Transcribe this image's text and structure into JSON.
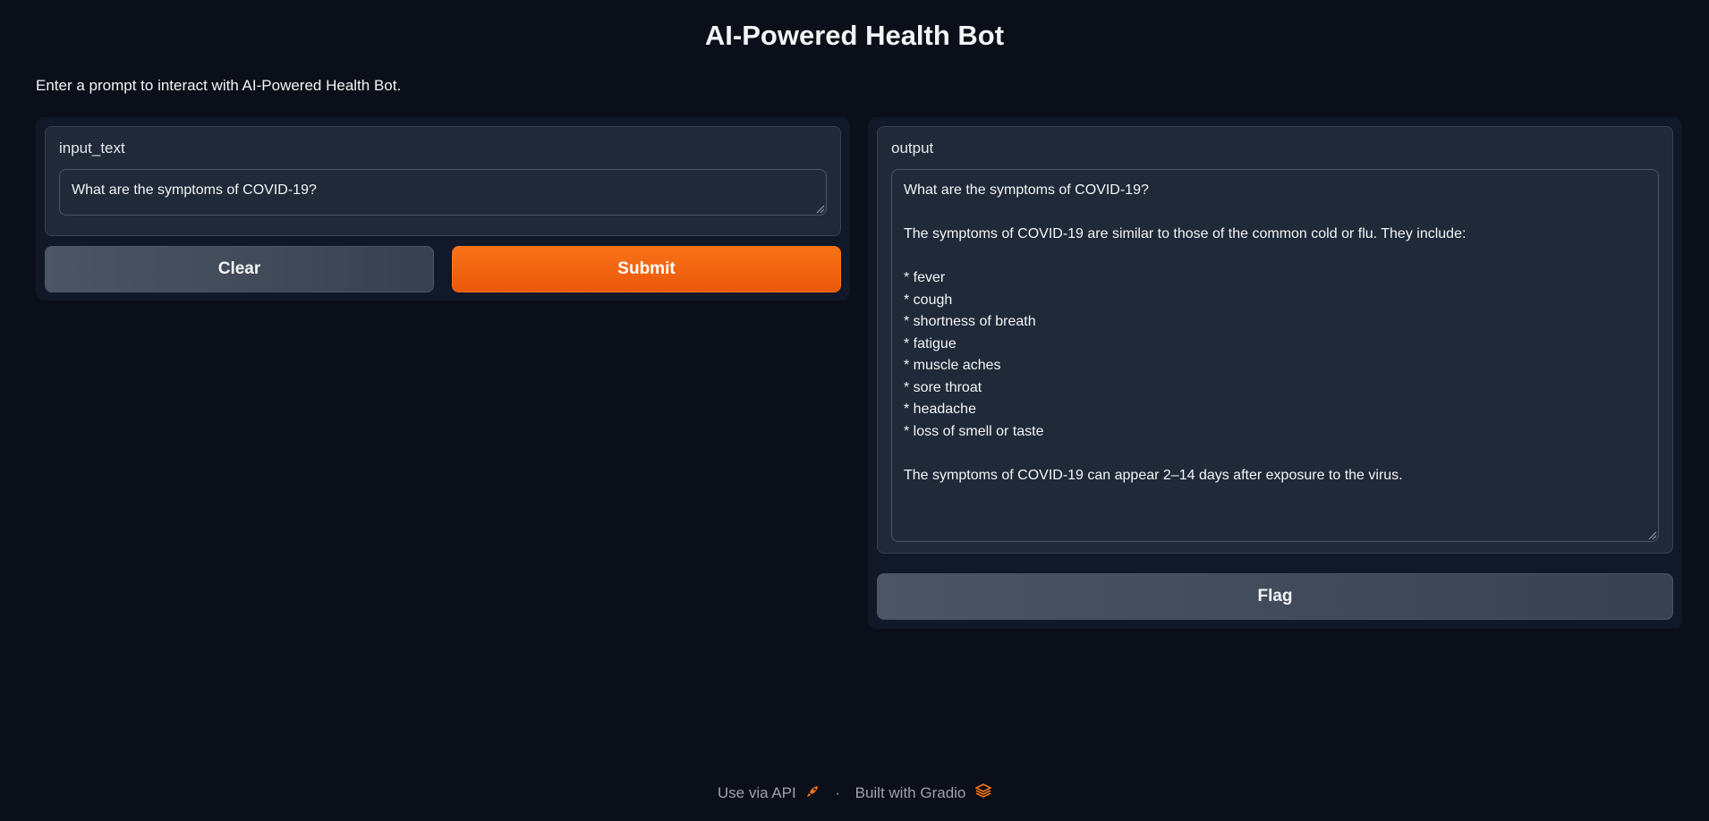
{
  "page": {
    "title": "AI-Powered Health Bot",
    "description": "Enter a prompt to interact with AI-Powered Health Bot."
  },
  "input": {
    "label": "input_text",
    "value": "What are the symptoms of COVID-19?"
  },
  "buttons": {
    "clear": "Clear",
    "submit": "Submit",
    "flag": "Flag"
  },
  "output": {
    "label": "output",
    "value": "What are the symptoms of COVID-19?\n\nThe symptoms of COVID-19 are similar to those of the common cold or flu. They include:\n\n* fever\n* cough\n* shortness of breath\n* fatigue\n* muscle aches\n* sore throat\n* headache\n* loss of smell or taste\n\nThe symptoms of COVID-19 can appear 2–14 days after exposure to the virus."
  },
  "footer": {
    "api_link": "Use via API",
    "separator": "·",
    "built_with": "Built with Gradio",
    "api_icon": "rocket-icon",
    "gradio_icon": "gradio-logo-icon"
  },
  "colors": {
    "background": "#0b0f19",
    "panel": "#111827",
    "block": "#1f2937",
    "accent": "#f97316"
  }
}
